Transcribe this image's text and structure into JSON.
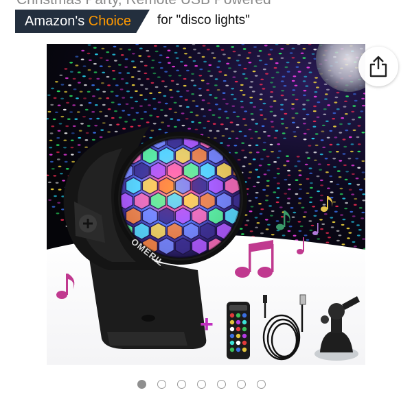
{
  "header": {
    "title_fragment": "Christmas Party, Remote USB Powered"
  },
  "badge": {
    "brand": "Amazon's",
    "choice": "Choice",
    "context": "for \"disco lights\""
  },
  "product_image": {
    "brand_mark": "OMERIL",
    "accessory_separator": "+"
  },
  "carousel": {
    "total": 7,
    "active_index": 0
  },
  "icons": {
    "share": "share-icon"
  },
  "colors": {
    "badge_bg": "#232f3e",
    "badge_accent": "#ff9900"
  }
}
